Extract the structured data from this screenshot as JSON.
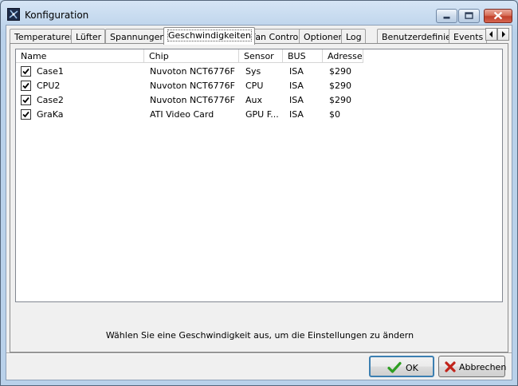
{
  "window": {
    "title": "Konfiguration"
  },
  "tabs": [
    {
      "label": "Temperaturen"
    },
    {
      "label": "Lüfter"
    },
    {
      "label": "Spannungen"
    },
    {
      "label": "Geschwindigkeiten",
      "active": true
    },
    {
      "label": "Fan Control"
    },
    {
      "label": "Optionen"
    },
    {
      "label": "Log"
    },
    {
      "label": "Benutzerdefiniert"
    },
    {
      "label": "Events"
    }
  ],
  "table": {
    "columns": [
      "Name",
      "Chip",
      "Sensor",
      "BUS",
      "Adresse"
    ],
    "rows": [
      {
        "checked": true,
        "name": "Case1",
        "chip": "Nuvoton NCT6776F",
        "sensor": "Sys",
        "bus": "ISA",
        "address": "$290"
      },
      {
        "checked": true,
        "name": "CPU2",
        "chip": "Nuvoton NCT6776F",
        "sensor": "CPU",
        "bus": "ISA",
        "address": "$290"
      },
      {
        "checked": true,
        "name": "Case2",
        "chip": "Nuvoton NCT6776F",
        "sensor": "Aux",
        "bus": "ISA",
        "address": "$290"
      },
      {
        "checked": true,
        "name": "GraKa",
        "chip": "ATI Video Card",
        "sensor": "GPU F...",
        "bus": "ISA",
        "address": "$0"
      }
    ]
  },
  "hint": "Wählen Sie eine Geschwindigkeit aus, um die Einstellungen zu ändern",
  "buttons": {
    "ok": "OK",
    "cancel": "Abbrechen"
  },
  "colors": {
    "ok_icon": "#2e9e22",
    "cancel_icon": "#c1241b",
    "titlebar": "#c2d6ea"
  }
}
